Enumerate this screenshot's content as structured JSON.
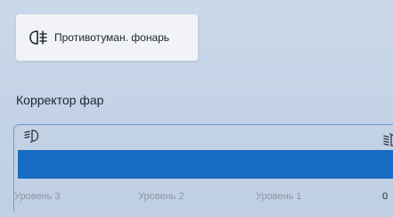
{
  "fog_light": {
    "label": "Противотуман. фонарь",
    "icon": "rear-fog-light-icon"
  },
  "headlight_corrector": {
    "title": "Корректор фар",
    "low_icon": "headlight-low-icon",
    "high_icon": "headlight-high-icon",
    "current_level": "0",
    "level_fill_fraction": 1.0,
    "levels": [
      "Уровень 3",
      "Уровень 2",
      "Уровень 1",
      "0"
    ]
  },
  "colors": {
    "accent": "#176bc1",
    "panel_border": "#6b9cd2",
    "background": "#c6d4e6",
    "button_bg": "#f1f3f6"
  }
}
